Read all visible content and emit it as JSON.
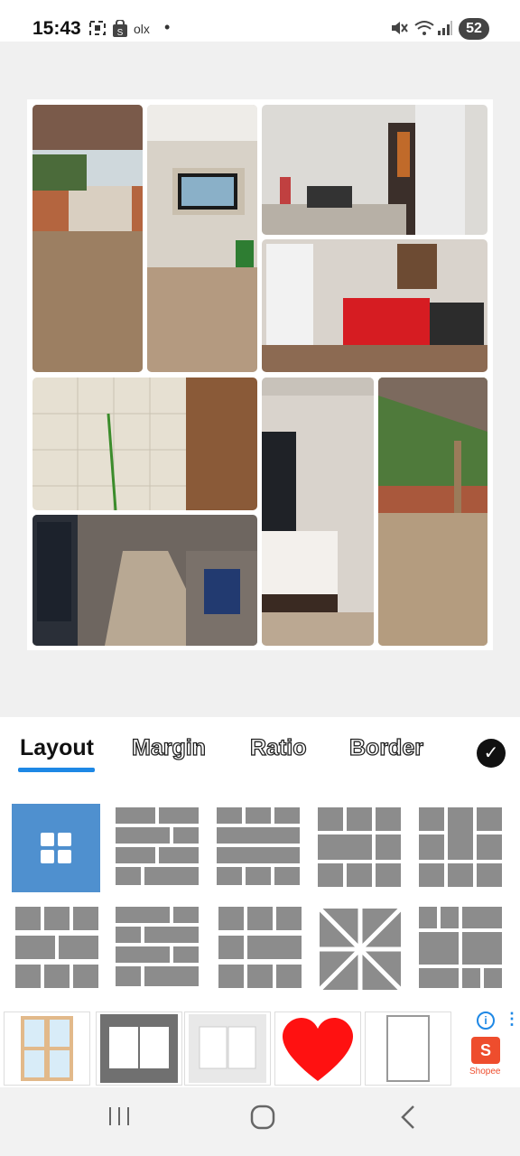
{
  "status": {
    "time": "15:43",
    "left_icons": [
      "screenshot-icon",
      "shopping-icon",
      "olx"
    ],
    "olx_label": "olx",
    "battery": "52"
  },
  "tabs": {
    "layout": "Layout",
    "margin": "Margin",
    "ratio": "Ratio",
    "border": "Border"
  },
  "ad": {
    "brand": "Shopee",
    "badge": "S"
  },
  "colors": {
    "accent": "#1e88e5",
    "selected_layout": "#4f90cf",
    "layout_block": "#8c8c8c",
    "shopee": "#ee4d2d",
    "heart": "#ff1111"
  }
}
